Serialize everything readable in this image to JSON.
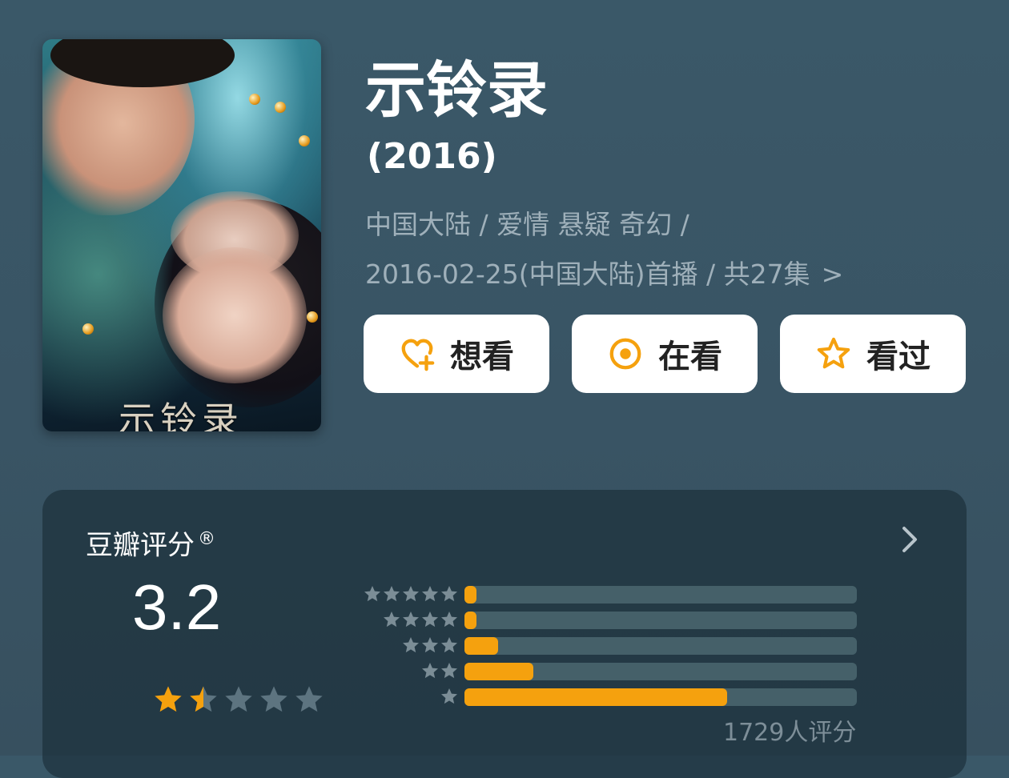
{
  "poster": {
    "title_text": "示铃录"
  },
  "title": "示铃录",
  "year": "(2016)",
  "meta_line1": "中国大陆 / 爱情 悬疑 奇幻 /",
  "meta_line2": "2016-02-25(中国大陆)首播 / 共27集",
  "meta_chevron": ">",
  "buttons": {
    "want": {
      "label": "想看",
      "icon": "heart-plus-icon"
    },
    "watching": {
      "label": "在看",
      "icon": "target-circle-icon"
    },
    "watched": {
      "label": "看过",
      "icon": "star-outline-icon"
    }
  },
  "accent_color": "#f5a10e",
  "rating": {
    "title": "豆瓣评分",
    "registered_mark": "®",
    "score": "3.2",
    "stars_filled": 1.5,
    "stars_total": 5,
    "distribution": [
      {
        "stars": 5,
        "percent": 3
      },
      {
        "stars": 4,
        "percent": 3
      },
      {
        "stars": 3,
        "percent": 8.5
      },
      {
        "stars": 2,
        "percent": 17.5
      },
      {
        "stars": 1,
        "percent": 67
      }
    ],
    "count_text": "1729人评分"
  }
}
